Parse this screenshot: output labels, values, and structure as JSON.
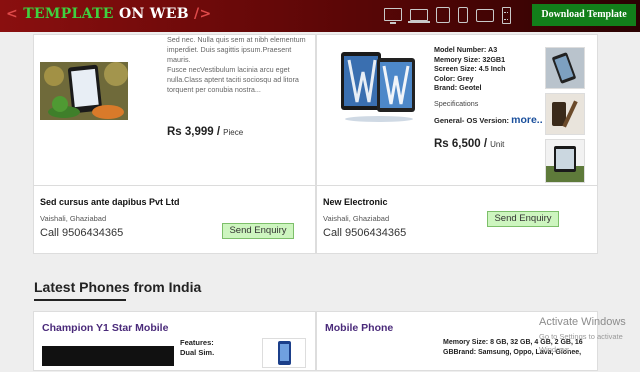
{
  "brand": {
    "open": "<",
    "word1": "TEMPLATE",
    "word2": "ON WEB",
    "close": "/>"
  },
  "header": {
    "download_label": "Download Template"
  },
  "device_icons": [
    "desktop-icon",
    "laptop-icon",
    "tablet-icon",
    "phone-icon",
    "tablet-landscape-icon",
    "feature-phone-icon"
  ],
  "products": [
    {
      "description_lines": [
        "Sed nec. Nulla quis sem at nibh elementum",
        "imperdiet. Duis sagittis ipsum.Praesent mauris.",
        "Fusce necVestibulum lacinia arcu eget",
        "nulla.Class aptent taciti sociosqu ad litora",
        "torquent per conubia nostra..."
      ],
      "price": "Rs 3,999 /",
      "unit": "Piece",
      "seller": "Sed cursus ante dapibus Pvt Ltd",
      "location": "Vaishali, Ghaziabad",
      "phone": "Call 9506434365",
      "enquiry_label": "Send Enquiry"
    },
    {
      "specs": [
        "Model Number: A3",
        "Memory Size: 32GB1",
        "Screen Size: 4.5 Inch",
        "Color: Grey",
        "Brand: Geotel"
      ],
      "specs_link": "Specifications",
      "os_label": "General- OS Version:",
      "more_label": "more..",
      "price": "Rs 6,500 /",
      "unit": "Unit",
      "seller": "New Electronic",
      "location": "Vaishali, Ghaziabad",
      "phone": "Call 9506434365",
      "enquiry_label": "Send Enquiry"
    }
  ],
  "latest": {
    "title": "Latest Phones from India",
    "items": [
      {
        "name": "Champion Y1 Star Mobile",
        "features": [
          "Features:",
          "Dual Sim."
        ]
      },
      {
        "name": "Mobile Phone",
        "specs": [
          "Memory Size: 8 GB, 32 GB, 4 GB, 2 GB, 16",
          "GBBrand: Samsung, Oppo, Lava, Gionee,"
        ]
      }
    ]
  },
  "watermark": {
    "line1": "Activate Windows",
    "line2": "Go to Settings to activate Windows."
  },
  "colors": {
    "topbar": "#7a0b0b",
    "brand_green": "#3fd13f",
    "download_bg": "#127f1a",
    "enquiry_bg": "#cdf5bf",
    "link_blue": "#1a4f9c",
    "title_purple": "#4a2a7a"
  }
}
